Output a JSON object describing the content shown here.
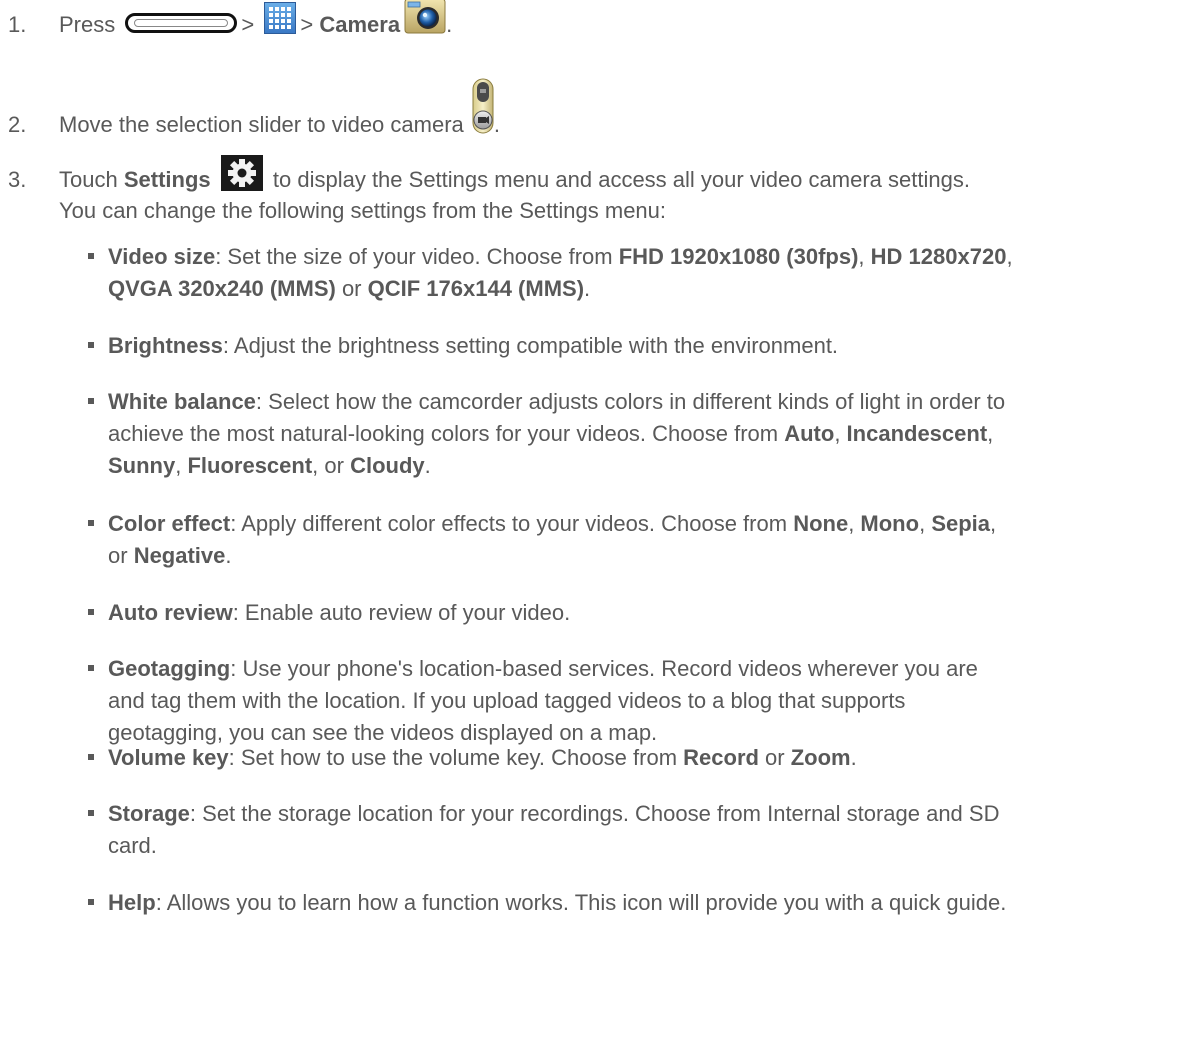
{
  "steps": [
    {
      "num": "1.",
      "press": "Press",
      "sep1": ">",
      "sep2": ">",
      "camera": "Camera",
      "end": ".",
      "icons": [
        "home-key-icon",
        "apps-icon",
        "camera-app-icon"
      ]
    },
    {
      "num": "2.",
      "text": "Move the selection slider to video camera",
      "end": ".",
      "icons": [
        "mode-slider-icon"
      ]
    },
    {
      "num": "3.",
      "touch": "Touch",
      "settings": "Settings",
      "rest": "to display the Settings menu and access all your video camera settings.",
      "line2": "You can change the following settings from the Settings menu:",
      "icons": [
        "gear-icon"
      ]
    }
  ],
  "settings_items": [
    {
      "label": "Video size",
      "parts": [
        ": Set the size of your video. Choose from ",
        {
          "b": "FHD 1920x1080 (30fps)"
        },
        ", ",
        {
          "b": "HD 1280x720"
        },
        ",",
        {
          "br": true
        },
        {
          "b": "QVGA 320x240 (MMS)"
        },
        " or ",
        {
          "b": "QCIF 176x144 (MMS)"
        },
        "."
      ]
    },
    {
      "label": "Brightness",
      "parts": [
        ": Adjust the brightness setting compatible with the environment."
      ]
    },
    {
      "label": "White balance",
      "parts": [
        ": Select how the camcorder adjusts colors in different kinds of light in order to",
        {
          "br": true
        },
        "achieve the most natural-looking colors for your videos. Choose from ",
        {
          "b": "Auto"
        },
        ", ",
        {
          "b": "Incandescent"
        },
        ",",
        {
          "br": true
        },
        {
          "b": "Sunny"
        },
        ", ",
        {
          "b": "Fluorescent"
        },
        ", or ",
        {
          "b": "Cloudy"
        },
        "."
      ]
    },
    {
      "label": "Color effect",
      "parts": [
        ": Apply different color effects to your videos. Choose from ",
        {
          "b": "None"
        },
        ", ",
        {
          "b": "Mono"
        },
        ", ",
        {
          "b": "Sepia"
        },
        ",",
        {
          "br": true
        },
        "or ",
        {
          "b": "Negative"
        },
        "."
      ]
    },
    {
      "label": "Auto review",
      "parts": [
        ": Enable auto review of your video."
      ]
    },
    {
      "label": "Geotagging",
      "parts": [
        ": Use your phone's location-based services. Record videos wherever you are",
        {
          "br": true
        },
        "and tag them with the location. If you upload tagged videos to a blog that supports",
        {
          "br": true
        },
        "geotagging, you can see the videos displayed on a map."
      ]
    },
    {
      "label": "Volume key",
      "parts": [
        ": Set how to use the volume key. Choose from ",
        {
          "b": "Record"
        },
        " or ",
        {
          "b": "Zoom"
        },
        "."
      ]
    },
    {
      "label": "Storage",
      "parts": [
        ": Set the storage location for your recordings. Choose from Internal storage and SD",
        {
          "br": true
        },
        "card."
      ]
    },
    {
      "label": "Help",
      "parts": [
        ": Allows you to learn how a function works. This icon will provide you with a quick guide."
      ]
    }
  ]
}
